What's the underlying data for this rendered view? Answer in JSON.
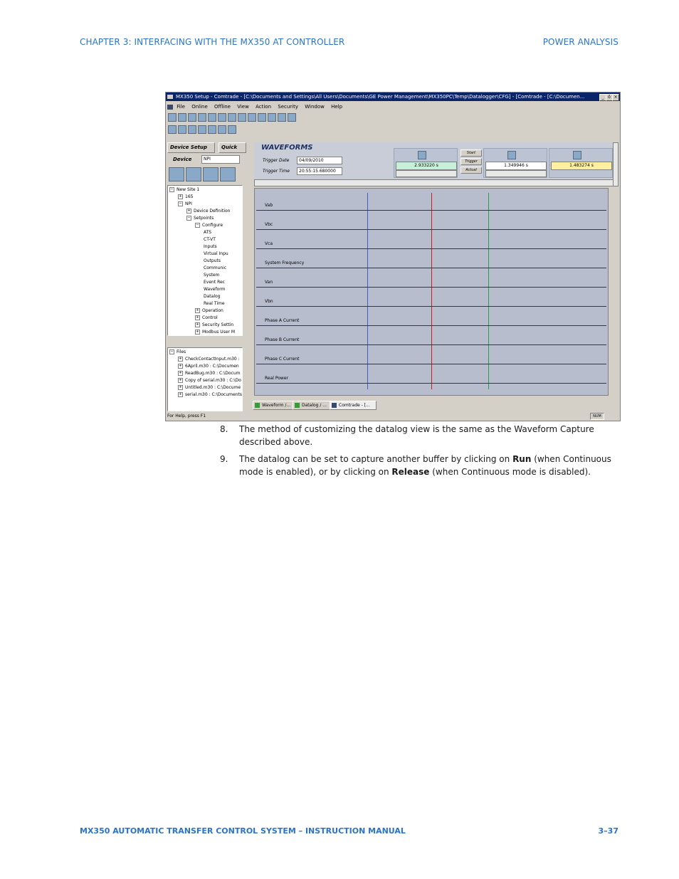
{
  "header": {
    "left": "CHAPTER 3: INTERFACING WITH THE MX350 AT CONTROLLER",
    "right": "POWER ANALYSIS"
  },
  "footer": {
    "left": "MX350 AUTOMATIC TRANSFER CONTROL SYSTEM – INSTRUCTION MANUAL",
    "right": "3–37"
  },
  "screenshot": {
    "title": "MX350 Setup - Comtrade - [C:\\Documents and Settings\\All Users\\Documents\\GE Power Management\\MX350PC\\Temp\\Datalogger\\CFG] - [Comtrade - [C:\\Documen...",
    "menu": [
      "File",
      "Online",
      "Offline",
      "View",
      "Action",
      "Security",
      "Window",
      "Help"
    ],
    "window_controls": [
      "_",
      "ő",
      "×"
    ],
    "left_tabs": [
      "Device Setup",
      "Quick"
    ],
    "device_label": "Device",
    "device_value": "NPI",
    "tree": [
      {
        "label": "New Site 1",
        "level": 0,
        "box": "−"
      },
      {
        "label": "165",
        "level": 1,
        "box": "+"
      },
      {
        "label": "NPI",
        "level": 1,
        "box": "−"
      },
      {
        "label": "Device Definition",
        "level": 2,
        "box": "+"
      },
      {
        "label": "Setpoints",
        "level": 2,
        "box": "−"
      },
      {
        "label": "Configure",
        "level": 3,
        "box": "−"
      },
      {
        "label": "ATS",
        "level": 4,
        "box": ""
      },
      {
        "label": "CT-VT",
        "level": 4,
        "box": ""
      },
      {
        "label": "Inputs",
        "level": 4,
        "box": ""
      },
      {
        "label": "Virtual Inpu",
        "level": 4,
        "box": ""
      },
      {
        "label": "Outputs",
        "level": 4,
        "box": ""
      },
      {
        "label": "Communic",
        "level": 4,
        "box": ""
      },
      {
        "label": "System",
        "level": 4,
        "box": ""
      },
      {
        "label": "Event Rec",
        "level": 4,
        "box": ""
      },
      {
        "label": "Waveform",
        "level": 4,
        "box": ""
      },
      {
        "label": "Datalog",
        "level": 4,
        "box": ""
      },
      {
        "label": "Real Time",
        "level": 4,
        "box": ""
      },
      {
        "label": "Operation",
        "level": 3,
        "box": "+"
      },
      {
        "label": "Control",
        "level": 3,
        "box": "+"
      },
      {
        "label": "Security Settin",
        "level": 3,
        "box": "+"
      },
      {
        "label": "Modbus User M",
        "level": 3,
        "box": "+"
      }
    ],
    "files": [
      {
        "label": "Files",
        "level": 0,
        "box": "−"
      },
      {
        "label": "CheckContactInput.m30 :",
        "level": 1,
        "box": "+"
      },
      {
        "label": "6April.m30 : C:\\Documen",
        "level": 1,
        "box": "+"
      },
      {
        "label": "ReadBug.m30 : C:\\Docum",
        "level": 1,
        "box": "+"
      },
      {
        "label": "Copy of serial.m30 : C:\\Do",
        "level": 1,
        "box": "+"
      },
      {
        "label": "Untitled.m30 : C:\\Docume",
        "level": 1,
        "box": "+"
      },
      {
        "label": "serial.m30 : C:\\Documents",
        "level": 1,
        "box": "+"
      }
    ],
    "waveforms_title": "WAVEFORMS",
    "trigger_date_label": "Trigger Date",
    "trigger_date": "04/09/2010",
    "trigger_time_label": "Trigger Time",
    "trigger_time": "20:55:15.680000",
    "cursor1": "2.933220 s",
    "cursor2": "1.349946 s",
    "cursor3": "1.483274 s",
    "buttons": [
      "Start",
      "Trigger",
      "Actual"
    ],
    "cursor_colors": [
      "#c8f0d8",
      "#ffffff",
      "#fff0a0"
    ],
    "traces": [
      "Vab",
      "Vbc",
      "Vca",
      "System Frequency",
      "Van",
      "Vbn",
      "Phase A Current",
      "Phase B Current",
      "Phase C Current",
      "Real Power"
    ],
    "tabs": [
      "Waveform /...",
      "Datalog / ...",
      "Comtrade - [..."
    ],
    "status_left": "For Help, press F1",
    "status_right": "NUM"
  },
  "steps": [
    {
      "num": "8.",
      "text": "The method of customizing the datalog view is the same as the Waveform Capture described above."
    },
    {
      "num": "9.",
      "pre": "The datalog can be set to capture another buffer by clicking on ",
      "b1": "Run",
      "mid": " (when Continuous mode is enabled), or by clicking on ",
      "b2": "Release",
      "post": " (when Continuous mode is disabled)."
    }
  ]
}
